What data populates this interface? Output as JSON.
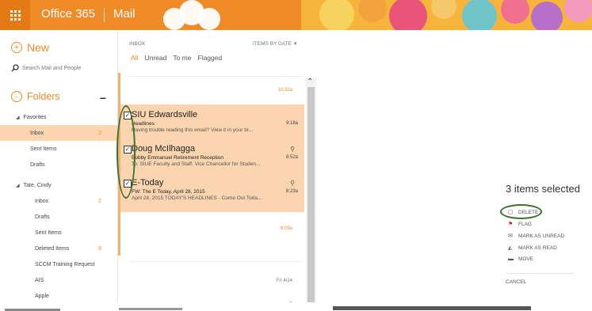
{
  "header": {
    "brand": "Office 365",
    "app": "Mail",
    "colors": {
      "bar": "#f08c28",
      "accent": "#f08c28",
      "annotation": "#3d6f2f"
    }
  },
  "sidebar": {
    "new_label": "New",
    "search_placeholder": "Search Mail and People",
    "folders_label": "Folders",
    "items": [
      {
        "label": "Favorites",
        "indent": 1,
        "expanded": true
      },
      {
        "label": "Inbox",
        "count": "2",
        "indent": 2,
        "selected": true
      },
      {
        "label": "Sent Items",
        "indent": 2
      },
      {
        "label": "Drafts",
        "indent": 2
      },
      {
        "label": "Tate, Cindy",
        "indent": 1,
        "expanded": true
      },
      {
        "label": "Inbox",
        "count": "2",
        "indent": 2
      },
      {
        "label": "Drafts",
        "indent": 2
      },
      {
        "label": "Sent Items",
        "indent": 2
      },
      {
        "label": "Deleted Items",
        "count": "8",
        "indent": 2
      },
      {
        "label": "SCCM Training Request",
        "indent": 2
      },
      {
        "label": "AIS",
        "indent": 2
      },
      {
        "label": "Apple",
        "indent": 2
      }
    ]
  },
  "list": {
    "header_label": "INBOX",
    "sort_label": "ITEMS BY DATE",
    "filters": [
      "All",
      "Unread",
      "To me",
      "Flagged"
    ],
    "active_filter": "All",
    "top_time": "10:32a",
    "messages": [
      {
        "from": "SIU Edwardsville",
        "subject": "Headlines",
        "preview": "Having trouble reading this email? View it in your br...",
        "time": "9:18a",
        "checked": true,
        "attachment": false
      },
      {
        "from": "Doug McIlhagga",
        "subject": "Bobby Emmanuel Retirement Reception",
        "preview": "To: SIUE Faculty and Staff, Vice Chancellor for Studen...",
        "time": "8:52a",
        "checked": true,
        "attachment": true
      },
      {
        "from": "E-Today",
        "subject": "FW: The E Today, April 28, 2015",
        "preview": "April 28, 2015 TODAY'S HEADLINES - Come Out Toda...",
        "time": "8:23a",
        "checked": true,
        "attachment": true
      }
    ],
    "below_time": "8:09a",
    "date_label": "Fri 4/24"
  },
  "reading": {
    "selected_text": "3 items selected",
    "actions": [
      {
        "label": "DELETE",
        "icon": "trash-icon"
      },
      {
        "label": "FLAG",
        "icon": "flag-icon"
      },
      {
        "label": "MARK AS UNREAD",
        "icon": "envelope-icon"
      },
      {
        "label": "MARK AS READ",
        "icon": "open-envelope-icon"
      },
      {
        "label": "MOVE",
        "icon": "folder-icon"
      }
    ],
    "cancel_label": "CANCEL"
  }
}
